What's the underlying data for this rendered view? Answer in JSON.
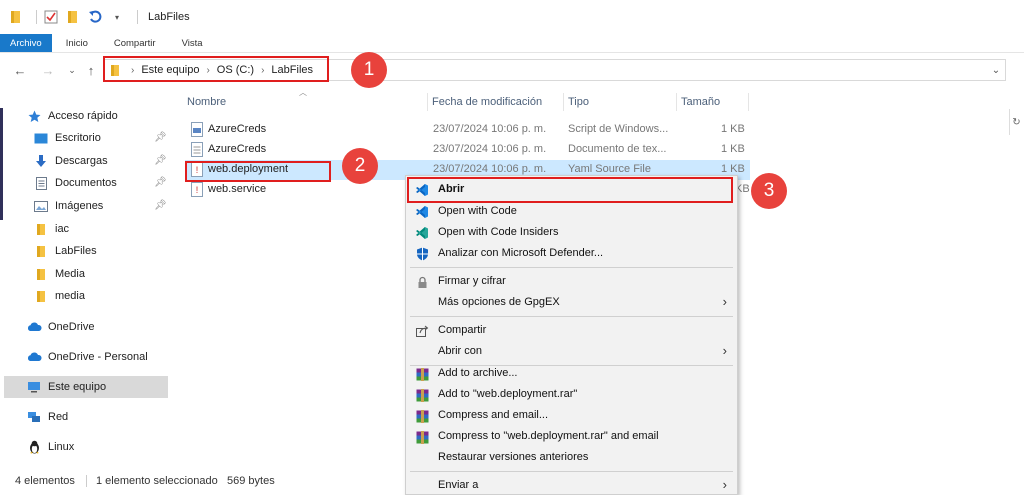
{
  "window": {
    "title": "LabFiles"
  },
  "ribbon": {
    "tabs": [
      "Archivo",
      "Inicio",
      "Compartir",
      "Vista"
    ]
  },
  "address": {
    "crumbs": [
      "Este equipo",
      "OS (C:)",
      "LabFiles"
    ]
  },
  "sidebar": {
    "items": [
      {
        "label": "Acceso rápido",
        "icon": "star-icon"
      },
      {
        "label": "Escritorio",
        "icon": "desktop-icon"
      },
      {
        "label": "Descargas",
        "icon": "download-icon"
      },
      {
        "label": "Documentos",
        "icon": "documents-icon"
      },
      {
        "label": "Imágenes",
        "icon": "pictures-icon"
      },
      {
        "label": "iac",
        "icon": "folder-icon"
      },
      {
        "label": "LabFiles",
        "icon": "folder-icon"
      },
      {
        "label": "Media",
        "icon": "folder-icon"
      },
      {
        "label": "media",
        "icon": "folder-icon"
      },
      {
        "label": "OneDrive",
        "icon": "cloud-icon"
      },
      {
        "label": "OneDrive - Personal",
        "icon": "cloud-icon"
      },
      {
        "label": "Este equipo",
        "icon": "computer-icon"
      },
      {
        "label": "Red",
        "icon": "network-icon"
      },
      {
        "label": "Linux",
        "icon": "linux-icon"
      }
    ]
  },
  "columns": {
    "name": "Nombre",
    "date": "Fecha de modificación",
    "type": "Tipo",
    "size": "Tamaño"
  },
  "files": [
    {
      "name": "AzureCreds",
      "date": "23/07/2024 10:06 p. m.",
      "type": "Script de Windows...",
      "size": "1 KB"
    },
    {
      "name": "AzureCreds",
      "date": "23/07/2024 10:06 p. m.",
      "type": "Documento de tex...",
      "size": "1 KB"
    },
    {
      "name": "web.deployment",
      "date": "23/07/2024 10:06 p. m.",
      "type": "Yaml Source File",
      "size": "1 KB"
    },
    {
      "name": "web.service",
      "date": "",
      "type": "",
      "size": "KB"
    }
  ],
  "context_menu": {
    "items": [
      {
        "label": "Abrir",
        "icon": "vscode-icon"
      },
      {
        "label": "Open with Code",
        "icon": "vscode-icon"
      },
      {
        "label": "Open with Code Insiders",
        "icon": "vscode-insiders-icon"
      },
      {
        "label": "Analizar con Microsoft Defender...",
        "icon": "defender-shield-icon"
      },
      {
        "label": "Firmar y cifrar",
        "icon": "lock-icon"
      },
      {
        "label": "Más opciones de GpgEX",
        "icon": ""
      },
      {
        "label": "Compartir",
        "icon": "share-icon"
      },
      {
        "label": "Abrir con",
        "icon": ""
      },
      {
        "label": "Add to archive...",
        "icon": "winrar-icon"
      },
      {
        "label": "Add to \"web.deployment.rar\"",
        "icon": "winrar-icon"
      },
      {
        "label": "Compress and email...",
        "icon": "winrar-icon"
      },
      {
        "label": "Compress to \"web.deployment.rar\" and email",
        "icon": "winrar-icon"
      },
      {
        "label": "Restaurar versiones anteriores",
        "icon": ""
      },
      {
        "label": "Enviar a",
        "icon": ""
      }
    ]
  },
  "status": {
    "count": "4 elementos",
    "selection": "1 elemento seleccionado",
    "size": "569 bytes"
  },
  "annotations": {
    "badge1": "1",
    "badge2": "2",
    "badge3": "3"
  },
  "colors": {
    "accent": "#1979ca",
    "selection": "#cce8ff",
    "annotation": "#e01e1e",
    "badge": "#e8423c"
  }
}
